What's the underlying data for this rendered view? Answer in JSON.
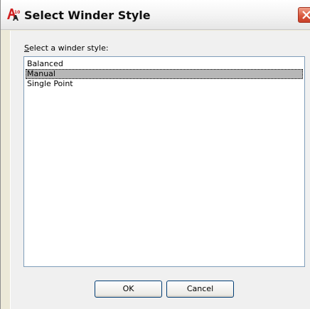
{
  "window": {
    "title": "Select Winder Style",
    "app_icon": "autocad-architecture-icon",
    "close_icon": "close-icon"
  },
  "prompt": {
    "mnemonic": "S",
    "rest": "elect a winder style:"
  },
  "winder_styles": {
    "items": [
      {
        "label": "Balanced",
        "selected": false
      },
      {
        "label": "Manual",
        "selected": true
      },
      {
        "label": "Single Point",
        "selected": false
      }
    ]
  },
  "buttons": {
    "ok_label": "OK",
    "cancel_label": "Cancel"
  },
  "colors": {
    "selection_highlight": "#b7b7b7",
    "close_button": "#d8553a",
    "button_border": "#003c74"
  }
}
